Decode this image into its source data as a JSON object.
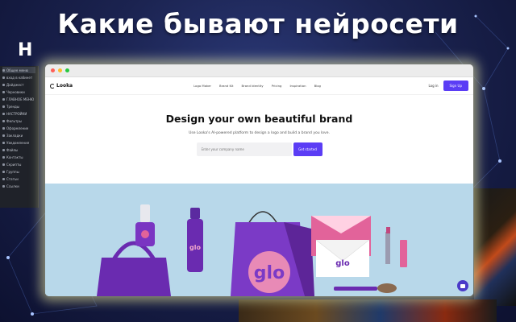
{
  "slide": {
    "title": "Какие бывают нейросети",
    "subtitle": "Н"
  },
  "sidebar": {
    "rows": [
      "Общее меню",
      "вход в кабинет",
      "Дайджест",
      "Черновики",
      "ГЛАВНОЕ МЕНЮ",
      "Тренды",
      "НАСТРОЙКИ",
      "Фильтры",
      "Оформление",
      "Закладки",
      "Уведомления",
      "Файлы",
      "Контакты",
      "Скрипты",
      "Группы",
      "Статьи",
      "Ссылки"
    ]
  },
  "browser": {
    "brand": "Looka",
    "menu": [
      "Logo Maker",
      "Brand Kit",
      "Brand Identity",
      "Pricing",
      "Inspiration",
      "Blog"
    ],
    "login": "Log in",
    "signup": "Sign Up",
    "hero_title": "Design your own beautiful brand",
    "hero_subtitle": "Use Looka's AI-powered platform to design a logo and build a brand you love.",
    "input_placeholder": "Enter your company name",
    "cta": "Get started"
  },
  "colors": {
    "accent": "#5b3df5",
    "brand_purple": "#6a2bb0",
    "photo_bg": "#b8d8ea",
    "pink": "#e2639a"
  }
}
